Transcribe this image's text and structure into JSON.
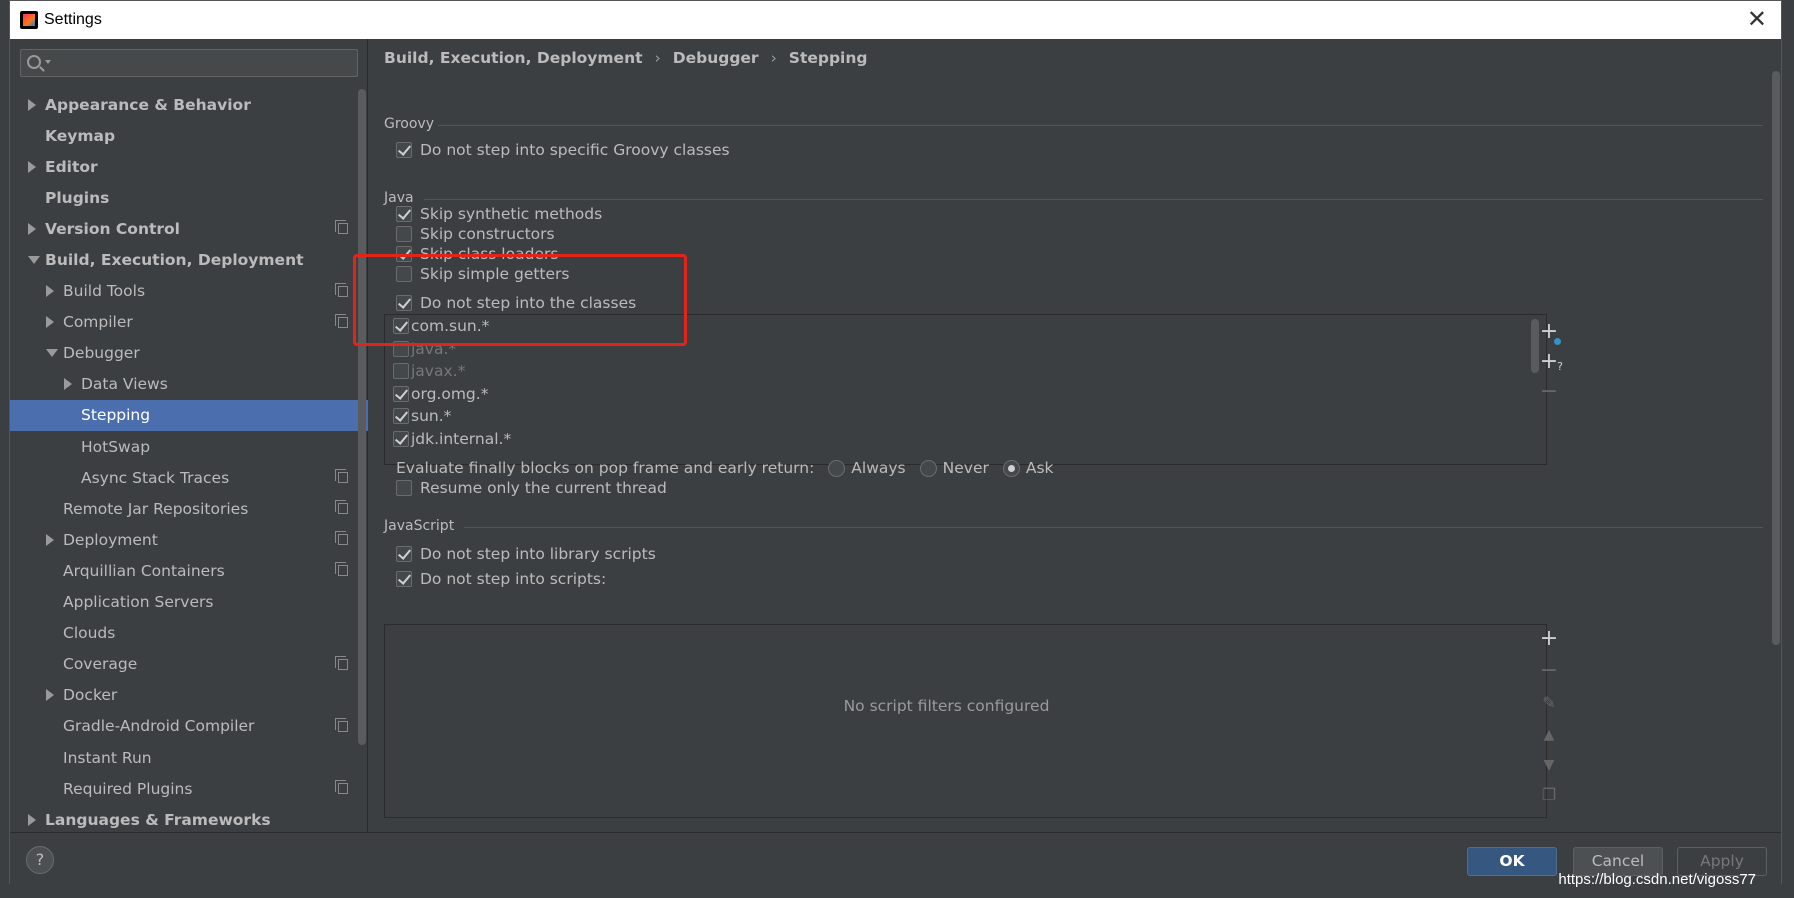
{
  "window": {
    "title": "Settings",
    "close": "✕"
  },
  "search": {
    "placeholder": "",
    "value": ""
  },
  "sidebar": {
    "items": [
      {
        "label": "Appearance & Behavior",
        "arrow": "right",
        "level": 0,
        "bold": true,
        "copy": false
      },
      {
        "label": "Keymap",
        "arrow": "",
        "level": 0,
        "bold": true,
        "copy": false
      },
      {
        "label": "Editor",
        "arrow": "right",
        "level": 0,
        "bold": true,
        "copy": false
      },
      {
        "label": "Plugins",
        "arrow": "",
        "level": 0,
        "bold": true,
        "copy": false
      },
      {
        "label": "Version Control",
        "arrow": "right",
        "level": 0,
        "bold": true,
        "copy": true
      },
      {
        "label": "Build, Execution, Deployment",
        "arrow": "down",
        "level": 0,
        "bold": true,
        "copy": false
      },
      {
        "label": "Build Tools",
        "arrow": "right",
        "level": 1,
        "bold": false,
        "copy": true
      },
      {
        "label": "Compiler",
        "arrow": "right",
        "level": 1,
        "bold": false,
        "copy": true
      },
      {
        "label": "Debugger",
        "arrow": "down",
        "level": 1,
        "bold": false,
        "copy": false
      },
      {
        "label": "Data Views",
        "arrow": "right",
        "level": 2,
        "bold": false,
        "copy": false
      },
      {
        "label": "Stepping",
        "arrow": "",
        "level": 2,
        "bold": false,
        "copy": false,
        "selected": true
      },
      {
        "label": "HotSwap",
        "arrow": "",
        "level": 2,
        "bold": false,
        "copy": false
      },
      {
        "label": "Async Stack Traces",
        "arrow": "",
        "level": 2,
        "bold": false,
        "copy": true
      },
      {
        "label": "Remote Jar Repositories",
        "arrow": "",
        "level": 1,
        "bold": false,
        "copy": true
      },
      {
        "label": "Deployment",
        "arrow": "right",
        "level": 1,
        "bold": false,
        "copy": true
      },
      {
        "label": "Arquillian Containers",
        "arrow": "",
        "level": 1,
        "bold": false,
        "copy": true
      },
      {
        "label": "Application Servers",
        "arrow": "",
        "level": 1,
        "bold": false,
        "copy": false
      },
      {
        "label": "Clouds",
        "arrow": "",
        "level": 1,
        "bold": false,
        "copy": false
      },
      {
        "label": "Coverage",
        "arrow": "",
        "level": 1,
        "bold": false,
        "copy": true
      },
      {
        "label": "Docker",
        "arrow": "right",
        "level": 1,
        "bold": false,
        "copy": false
      },
      {
        "label": "Gradle-Android Compiler",
        "arrow": "",
        "level": 1,
        "bold": false,
        "copy": true
      },
      {
        "label": "Instant Run",
        "arrow": "",
        "level": 1,
        "bold": false,
        "copy": false
      },
      {
        "label": "Required Plugins",
        "arrow": "",
        "level": 1,
        "bold": false,
        "copy": true
      },
      {
        "label": "Languages & Frameworks",
        "arrow": "right",
        "level": 0,
        "bold": true,
        "copy": false
      }
    ]
  },
  "breadcrumb": {
    "part1": "Build, Execution, Deployment",
    "sep": "›",
    "part2": "Debugger",
    "part3": "Stepping"
  },
  "groovy": {
    "title": "Groovy",
    "option": {
      "label": "Do not step into specific Groovy classes",
      "checked": true
    }
  },
  "java": {
    "title": "Java",
    "options": [
      {
        "label": "Skip synthetic methods",
        "checked": true
      },
      {
        "label": "Skip constructors",
        "checked": false
      },
      {
        "label": "Skip class loaders",
        "checked": true
      },
      {
        "label": "Skip simple getters",
        "checked": false
      }
    ],
    "classes_label": "Do not step into the classes",
    "classes_checked": true,
    "classes": [
      {
        "label": "com.sun.*",
        "checked": true,
        "dim": false
      },
      {
        "label": "java.*",
        "checked": false,
        "dim": true
      },
      {
        "label": "javax.*",
        "checked": false,
        "dim": true
      },
      {
        "label": "org.omg.*",
        "checked": true,
        "dim": false
      },
      {
        "label": "sun.*",
        "checked": true,
        "dim": false
      },
      {
        "label": "jdk.internal.*",
        "checked": true,
        "dim": false
      }
    ],
    "evaluate_label": "Evaluate finally blocks on pop frame and early return:",
    "radios": [
      {
        "label": "Always",
        "checked": false
      },
      {
        "label": "Never",
        "checked": false
      },
      {
        "label": "Ask",
        "checked": true
      }
    ],
    "resume_label": "Resume only the current thread",
    "resume_checked": false
  },
  "javascript": {
    "title": "JavaScript",
    "options": [
      {
        "label": "Do not step into library scripts",
        "checked": true
      },
      {
        "label": "Do not step into scripts:",
        "checked": true
      }
    ],
    "empty_text": "No script filters configured"
  },
  "footer": {
    "help": "?",
    "ok": "OK",
    "cancel": "Cancel",
    "apply": "Apply"
  },
  "watermark": "https://blog.csdn.net/vigoss77",
  "colors": {
    "selection": "#4b6eaf",
    "highlight_box": "#e3241b",
    "ok_button": "#365880"
  }
}
